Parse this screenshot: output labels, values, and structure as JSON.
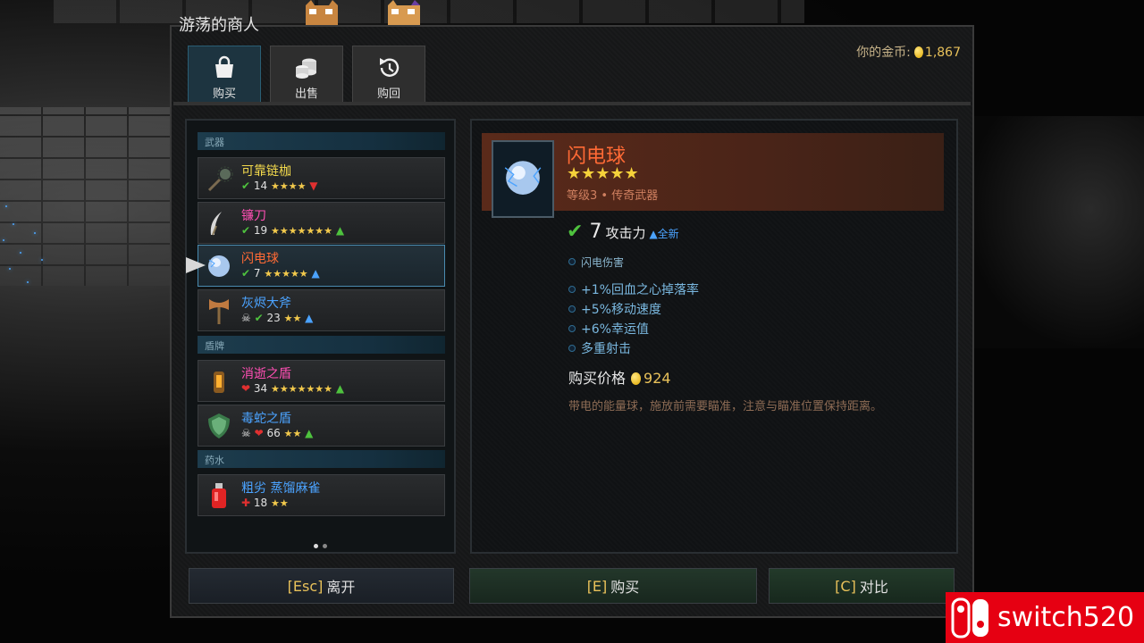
{
  "window": {
    "title": "游荡的商人"
  },
  "gold": {
    "label": "你的金币:",
    "amount": "1,867"
  },
  "tabs": [
    {
      "label": "购买",
      "icon": "shopping-bag-icon",
      "active": true
    },
    {
      "label": "出售",
      "icon": "coin-stack-icon",
      "active": false
    },
    {
      "label": "购回",
      "icon": "history-icon",
      "active": false
    }
  ],
  "categories": {
    "weapons": "武器",
    "shields": "盾牌",
    "potions": "药水"
  },
  "items": [
    {
      "name": "可靠链枷",
      "color": "#f2d94c",
      "stat": "14",
      "stars": "★★★★",
      "trend": "▼",
      "trend_color": "#e03030"
    },
    {
      "name": "镰刀",
      "color": "#ff4fb4",
      "stat": "19",
      "stars": "★★★★★★★",
      "trend": "▲",
      "trend_color": "#4ec23e"
    },
    {
      "name": "闪电球",
      "color": "#ff6a35",
      "stat": "7",
      "stars": "★★★★★",
      "trend": "▲",
      "trend_color": "#4ba3ff"
    },
    {
      "name": "灰烬大斧",
      "color": "#4ba3ff",
      "stat": "23",
      "stars": "★★",
      "trend": "▲",
      "trend_color": "#4ba3ff"
    },
    {
      "name": "消逝之盾",
      "color": "#ff4fb4",
      "stat": "34",
      "stars": "★★★★★★★",
      "trend": "▲",
      "trend_color": "#4ec23e"
    },
    {
      "name": "毒蛇之盾",
      "color": "#4ba3ff",
      "stat": "66",
      "stars": "★★",
      "trend": "▲",
      "trend_color": "#4ec23e"
    },
    {
      "name": "粗劣 蒸馏麻雀",
      "color": "#4ba3ff",
      "stat": "18",
      "stars": "★★",
      "trend": "",
      "trend_color": "#4ec23e"
    }
  ],
  "detail": {
    "name": "闪电球",
    "stars": "★★★★★",
    "level": "等级3 • 传奇武器",
    "attack_value": "7",
    "attack_label": "攻击力",
    "attack_note": "▲全新",
    "damage_type": "闪电伤害",
    "bonuses": [
      "+1%回血之心掉落率",
      "+5%移动速度",
      "+6%幸运值",
      "多重射击"
    ],
    "price_label": "购买价格",
    "price": "924",
    "description": "带电的能量球，施放前需要瞄准，注意与瞄准位置保持距离。"
  },
  "buttons": {
    "leave_key": "[Esc]",
    "leave_label": "离开",
    "buy_key": "[E]",
    "buy_label": "购买",
    "compare_key": "[C]",
    "compare_label": "对比"
  },
  "pager": {
    "pages": 2,
    "current": 1
  },
  "watermark": {
    "text": "switch520"
  }
}
